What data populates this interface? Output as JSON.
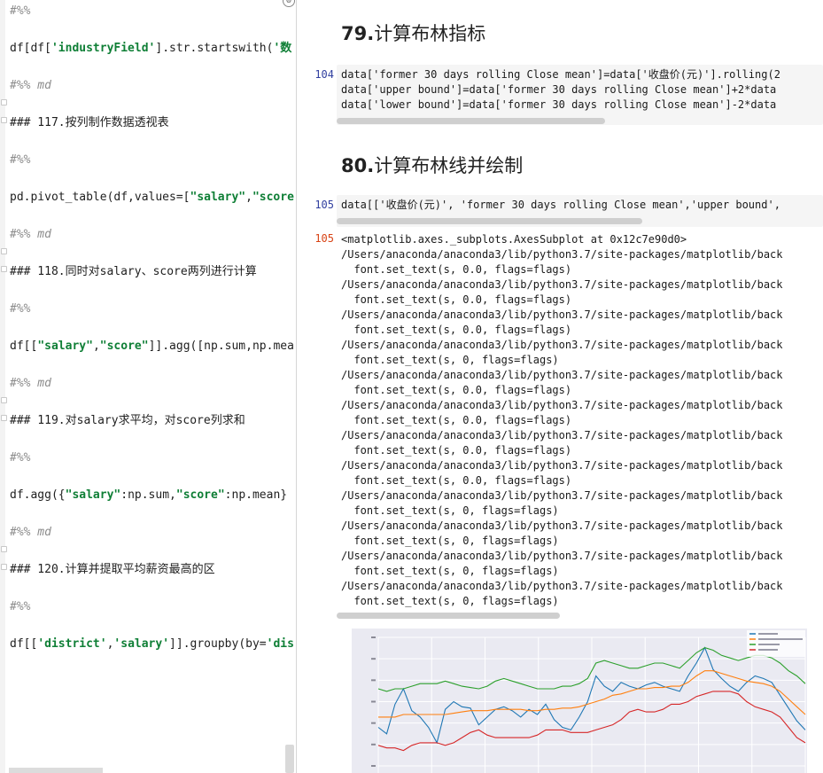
{
  "left_editor": {
    "lines": [
      {
        "text": "#%%",
        "kind": "comment"
      },
      {
        "parts": [
          [
            "df[df[",
            ""
          ],
          [
            "'industryField'",
            "str"
          ],
          [
            "].str.startswith(",
            ""
          ],
          [
            "'数",
            "str"
          ]
        ]
      },
      {
        "text": "#%% md",
        "kind": "comment"
      },
      {
        "text": "### 117.按列制作数据透视表",
        "kind": "plain"
      },
      {
        "text": "#%%",
        "kind": "comment"
      },
      {
        "parts": [
          [
            "pd.pivot_table(df,values=[",
            ""
          ],
          [
            "\"salary\"",
            "str"
          ],
          [
            ",",
            ""
          ],
          [
            "\"score",
            "str"
          ]
        ]
      },
      {
        "text": "#%% md",
        "kind": "comment"
      },
      {
        "text": "### 118.同时对salary、score两列进行计算",
        "kind": "plain"
      },
      {
        "text": "#%%",
        "kind": "comment"
      },
      {
        "parts": [
          [
            "df[[",
            ""
          ],
          [
            "\"salary\"",
            "str"
          ],
          [
            ",",
            ""
          ],
          [
            "\"score\"",
            "str"
          ],
          [
            "]].agg([np.sum,np.mea",
            ""
          ]
        ]
      },
      {
        "text": "#%% md",
        "kind": "comment"
      },
      {
        "text": "### 119.对salary求平均，对score列求和",
        "kind": "plain"
      },
      {
        "text": "#%%",
        "kind": "comment"
      },
      {
        "parts": [
          [
            "df.agg({",
            ""
          ],
          [
            "\"salary\"",
            "str"
          ],
          [
            ":np.sum,",
            ""
          ],
          [
            "\"score\"",
            "str"
          ],
          [
            ":np.mean}",
            ""
          ]
        ]
      },
      {
        "text": "#%% md",
        "kind": "comment"
      },
      {
        "text": "### 120.计算并提取平均薪资最高的区",
        "kind": "plain"
      },
      {
        "text": "#%%",
        "kind": "comment"
      },
      {
        "parts": [
          [
            "df[[",
            ""
          ],
          [
            "'district'",
            "str"
          ],
          [
            ",",
            ""
          ],
          [
            "'salary'",
            "str"
          ],
          [
            "]].groupby(by=",
            ""
          ],
          [
            "'dis",
            "str"
          ]
        ]
      }
    ]
  },
  "notebook": {
    "heading79": {
      "number": "79.",
      "text": "计算布林指标"
    },
    "cell104": {
      "prompt": "104",
      "lines": [
        "data['former 30 days rolling Close mean']=data['收盘价(元)'].rolling(2",
        "data['upper bound']=data['former 30 days rolling Close mean']+2*data",
        "data['lower bound']=data['former 30 days rolling Close mean']-2*data"
      ]
    },
    "heading80": {
      "number": "80.",
      "text": "计算布林线并绘制"
    },
    "cell105": {
      "prompt": "105",
      "line": "data[['收盘价(元)', 'former 30 days rolling Close mean','upper bound',"
    },
    "out105": {
      "prompt": "105",
      "lines": [
        "<matplotlib.axes._subplots.AxesSubplot at 0x12c7e90d0>",
        "/Users/anaconda/anaconda3/lib/python3.7/site-packages/matplotlib/back",
        "  font.set_text(s, 0.0, flags=flags)",
        "/Users/anaconda/anaconda3/lib/python3.7/site-packages/matplotlib/back",
        "  font.set_text(s, 0.0, flags=flags)",
        "/Users/anaconda/anaconda3/lib/python3.7/site-packages/matplotlib/back",
        "  font.set_text(s, 0.0, flags=flags)",
        "/Users/anaconda/anaconda3/lib/python3.7/site-packages/matplotlib/back",
        "  font.set_text(s, 0, flags=flags)",
        "/Users/anaconda/anaconda3/lib/python3.7/site-packages/matplotlib/back",
        "  font.set_text(s, 0.0, flags=flags)",
        "/Users/anaconda/anaconda3/lib/python3.7/site-packages/matplotlib/back",
        "  font.set_text(s, 0.0, flags=flags)",
        "/Users/anaconda/anaconda3/lib/python3.7/site-packages/matplotlib/back",
        "  font.set_text(s, 0.0, flags=flags)",
        "/Users/anaconda/anaconda3/lib/python3.7/site-packages/matplotlib/back",
        "  font.set_text(s, 0.0, flags=flags)",
        "/Users/anaconda/anaconda3/lib/python3.7/site-packages/matplotlib/back",
        "  font.set_text(s, 0, flags=flags)",
        "/Users/anaconda/anaconda3/lib/python3.7/site-packages/matplotlib/back",
        "  font.set_text(s, 0, flags=flags)",
        "/Users/anaconda/anaconda3/lib/python3.7/site-packages/matplotlib/back",
        "  font.set_text(s, 0, flags=flags)",
        "/Users/anaconda/anaconda3/lib/python3.7/site-packages/matplotlib/back",
        "  font.set_text(s, 0, flags=flags)"
      ]
    }
  },
  "chart_data": {
    "type": "line",
    "background": "#eaeaf2",
    "series": [
      {
        "color": "#1f77b4",
        "values": [
          30,
          25,
          48,
          60,
          43,
          38,
          30,
          18,
          44,
          50,
          46,
          45,
          32,
          38,
          44,
          46,
          43,
          38,
          44,
          40,
          48,
          36,
          30,
          28,
          38,
          50,
          70,
          62,
          58,
          65,
          62,
          60,
          63,
          65,
          62,
          60,
          58,
          70,
          80,
          92,
          75,
          68,
          62,
          58,
          65,
          70,
          68,
          65,
          55,
          45,
          35,
          28
        ]
      },
      {
        "color": "#ff7f0e",
        "values": [
          38,
          38,
          38,
          40,
          40,
          40,
          40,
          40,
          40,
          41,
          42,
          43,
          43,
          43,
          44,
          44,
          44,
          44,
          43,
          43,
          44,
          44,
          45,
          45,
          46,
          48,
          50,
          52,
          55,
          56,
          58,
          60,
          60,
          61,
          61,
          62,
          62,
          65,
          70,
          74,
          74,
          72,
          70,
          68,
          66,
          65,
          64,
          62,
          58,
          52,
          46,
          40
        ]
      },
      {
        "color": "#2ca02c",
        "values": [
          60,
          58,
          60,
          60,
          62,
          64,
          64,
          64,
          66,
          64,
          62,
          61,
          60,
          62,
          66,
          68,
          66,
          64,
          62,
          60,
          60,
          60,
          62,
          62,
          64,
          68,
          80,
          82,
          80,
          78,
          76,
          76,
          78,
          80,
          80,
          78,
          76,
          82,
          88,
          92,
          90,
          86,
          84,
          82,
          84,
          86,
          86,
          84,
          80,
          74,
          70,
          64
        ]
      },
      {
        "color": "#d62728",
        "values": [
          16,
          14,
          14,
          12,
          16,
          18,
          18,
          18,
          16,
          18,
          22,
          26,
          28,
          24,
          22,
          22,
          22,
          22,
          22,
          24,
          28,
          28,
          28,
          26,
          26,
          26,
          28,
          30,
          32,
          36,
          42,
          44,
          42,
          42,
          44,
          48,
          48,
          50,
          54,
          56,
          58,
          58,
          58,
          56,
          50,
          46,
          44,
          42,
          38,
          30,
          22,
          18
        ]
      }
    ]
  }
}
